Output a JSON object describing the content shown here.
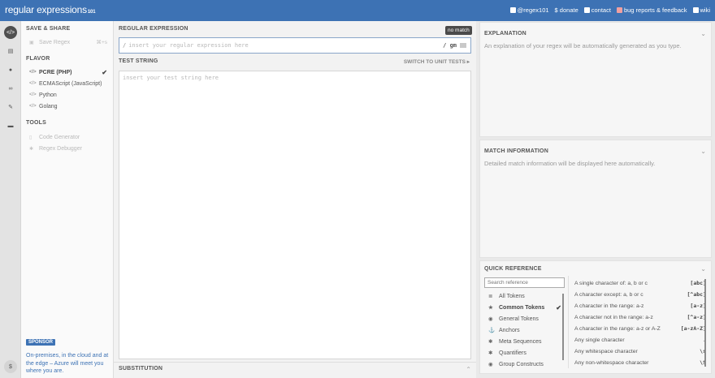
{
  "header": {
    "logo": "regular expressions",
    "logo_version": "101",
    "links": [
      {
        "icon": "twitter-icon",
        "label": "@regex101"
      },
      {
        "icon": "dollar-icon",
        "label": "$ donate"
      },
      {
        "icon": "mail-icon",
        "label": "contact"
      },
      {
        "icon": "bug-icon",
        "label": "bug reports & feedback"
      },
      {
        "icon": "book-icon",
        "label": "wiki"
      }
    ]
  },
  "rail": {
    "icons": [
      "code-icon",
      "library-icon",
      "user-icon",
      "glasses-icon",
      "wrench-icon",
      "chat-icon",
      "dollar-icon"
    ]
  },
  "sidebar": {
    "save_share_heading": "SAVE & SHARE",
    "save_regex": {
      "label": "Save Regex",
      "shortcut": "⌘+s"
    },
    "flavor_heading": "FLAVOR",
    "flavors": [
      {
        "label": "PCRE (PHP)",
        "selected": true
      },
      {
        "label": "ECMAScript (JavaScript)",
        "selected": false
      },
      {
        "label": "Python",
        "selected": false
      },
      {
        "label": "Golang",
        "selected": false
      }
    ],
    "tools_heading": "TOOLS",
    "tools": [
      {
        "label": "Code Generator"
      },
      {
        "label": "Regex Debugger"
      }
    ],
    "sponsor_badge": "SPONSOR",
    "sponsor_text": "On-premises, in the cloud and at the edge – Azure will meet you where you are."
  },
  "editor": {
    "regex_heading": "REGULAR EXPRESSION",
    "match_status": "no match",
    "delimiter": "/",
    "regex_placeholder": "insert your regular expression here",
    "regex_value": "",
    "flags": "/ gm",
    "test_heading": "TEST STRING",
    "unit_tests_link": "SWITCH TO UNIT TESTS ▸",
    "test_placeholder": "insert your test string here",
    "test_value": "",
    "substitution_heading": "SUBSTITUTION"
  },
  "explanation": {
    "title": "EXPLANATION",
    "text": "An explanation of your regex will be automatically generated as you type."
  },
  "match_info": {
    "title": "MATCH INFORMATION",
    "text": "Detailed match information will be displayed here automatically."
  },
  "quick_reference": {
    "title": "QUICK REFERENCE",
    "search_placeholder": "Search reference",
    "categories": [
      {
        "icon": "list-icon",
        "label": "All Tokens",
        "selected": false
      },
      {
        "icon": "star-icon",
        "label": "Common Tokens",
        "selected": true
      },
      {
        "icon": "circle-icon",
        "label": "General Tokens",
        "selected": false
      },
      {
        "icon": "anchor-icon",
        "label": "Anchors",
        "selected": false
      },
      {
        "icon": "asterisk-icon",
        "label": "Meta Sequences",
        "selected": false
      },
      {
        "icon": "asterisk-icon",
        "label": "Quantifiers",
        "selected": false
      },
      {
        "icon": "circle-icon",
        "label": "Group Constructs",
        "selected": false
      }
    ],
    "tokens": [
      {
        "desc": "A single character of: a, b or c",
        "token": "[abc]"
      },
      {
        "desc": "A character except: a, b or c",
        "token": "[^abc]"
      },
      {
        "desc": "A character in the range: a-z",
        "token": "[a-z]"
      },
      {
        "desc": "A character not in the range: a-z",
        "token": "[^a-z]"
      },
      {
        "desc": "A character in the range: a-z or A-Z",
        "token": "[a-zA-Z]"
      },
      {
        "desc": "Any single character",
        "token": "."
      },
      {
        "desc": "Any whitespace character",
        "token": "\\s"
      },
      {
        "desc": "Any non-whitespace character",
        "token": "\\S"
      }
    ]
  },
  "colors": {
    "brand": "#3d72b4",
    "match_badge": "#4a4a4a"
  }
}
